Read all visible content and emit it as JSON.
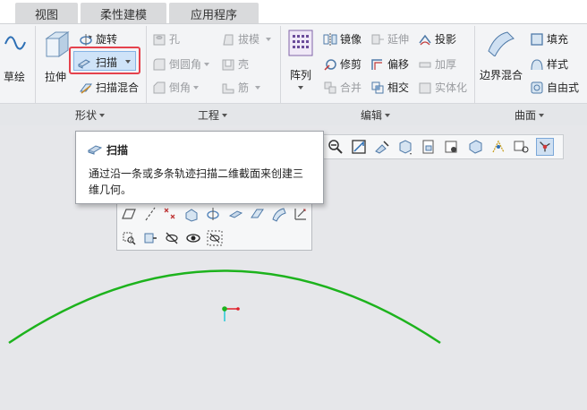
{
  "tabs": [
    {
      "label": "视图"
    },
    {
      "label": "柔性建模"
    },
    {
      "label": "应用程序"
    }
  ],
  "ribbon": {
    "sketch": {
      "label": "草绘"
    },
    "shape": {
      "extrude": "拉伸",
      "revolve": "旋转",
      "sweep": "扫描",
      "swept_blend": "扫描混合",
      "group_label": "形状"
    },
    "engineering": {
      "hole": "孔",
      "round": "倒圆角",
      "chamfer": "倒角",
      "draft": "拔模",
      "shell": "壳",
      "rib": "筋",
      "group_label": "工程"
    },
    "editing": {
      "pattern": "阵列",
      "mirror": "镜像",
      "extend": "延伸",
      "project": "投影",
      "trim": "修剪",
      "offset": "偏移",
      "thicken": "加厚",
      "merge": "合并",
      "intersect": "相交",
      "solidify": "实体化",
      "group_label": "编辑"
    },
    "surfaces": {
      "boundary_blend": "边界混合",
      "fill": "填充",
      "style": "样式",
      "freeform": "自由式",
      "group_label": "曲面"
    }
  },
  "tooltip": {
    "title": "扫描",
    "description": "通过沿一条或多条轨迹扫描二维截面来创建三维几何。"
  },
  "graphics_toolbar": {
    "icons": [
      "zoom-out-icon",
      "refit-icon",
      "repaint-icon",
      "display-style-icon",
      "saved-views-icon",
      "view-manager-icon",
      "perspective-icon",
      "datum-display-icon",
      "annotation-display-icon",
      "spin-center-icon"
    ]
  },
  "colors": {
    "accent_highlight": "#e5424d",
    "curve": "#1db31d",
    "csys_x": "#e0202a",
    "csys_y": "#25c8d8"
  }
}
